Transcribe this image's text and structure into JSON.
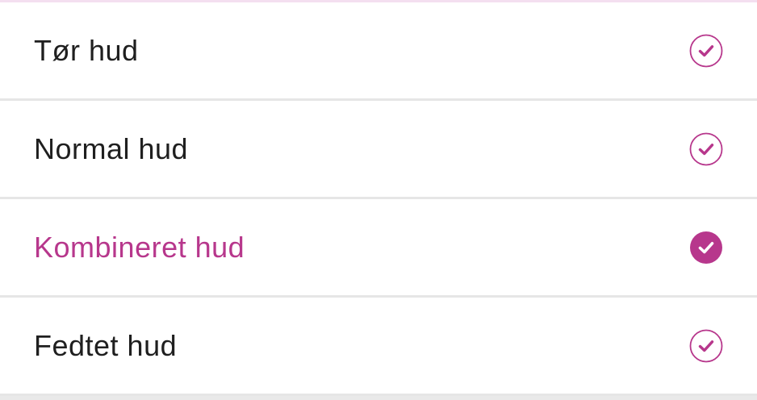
{
  "accent_color": "#b7378c",
  "skin_type_list": {
    "items": [
      {
        "label": "Tør hud",
        "selected": false,
        "icon": "check-circle-outline-icon"
      },
      {
        "label": "Normal hud",
        "selected": false,
        "icon": "check-circle-outline-icon"
      },
      {
        "label": "Kombineret hud",
        "selected": true,
        "icon": "check-circle-filled-icon"
      },
      {
        "label": "Fedtet hud",
        "selected": false,
        "icon": "check-circle-outline-icon"
      }
    ]
  }
}
